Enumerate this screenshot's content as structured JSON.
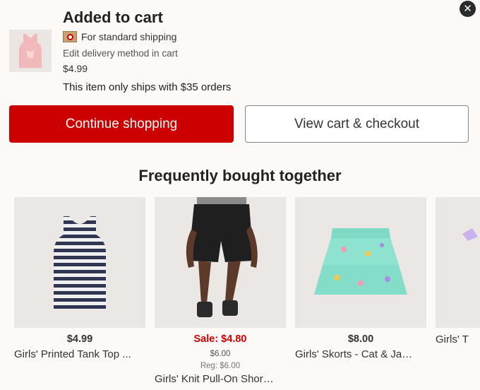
{
  "header": {
    "title": "Added to cart",
    "shipping_label": "For standard shipping",
    "edit_link": "Edit delivery method in cart",
    "price": "$4.99",
    "min_order_note": "This item only ships with $35 orders",
    "close_glyph": "✕",
    "thumbnail_icon": "pink-tank-top-thumbnail",
    "shipping_icon": "box-target-icon"
  },
  "buttons": {
    "continue_label": "Continue shopping",
    "checkout_label": "View cart & checkout"
  },
  "colors": {
    "accent": "#cc0000",
    "background": "#fcf9f7"
  },
  "fbt": {
    "heading": "Frequently bought together",
    "items": [
      {
        "price": "$4.99",
        "title": "Girls' Printed Tank Top ...",
        "image": "striped-tank-top-image"
      },
      {
        "price": "Sale: $4.80",
        "sub_price": "$6.00",
        "reg_price": "Reg: $6.00",
        "title": "Girls' Knit Pull-On Shor…",
        "image": "black-shorts-model-image"
      },
      {
        "price": "$8.00",
        "title": "Girls' Skorts - Cat & Ja…",
        "image": "mint-rainbow-skort-image"
      },
      {
        "price": "",
        "title": "Girls' T",
        "image": "purple-item-image"
      }
    ]
  }
}
